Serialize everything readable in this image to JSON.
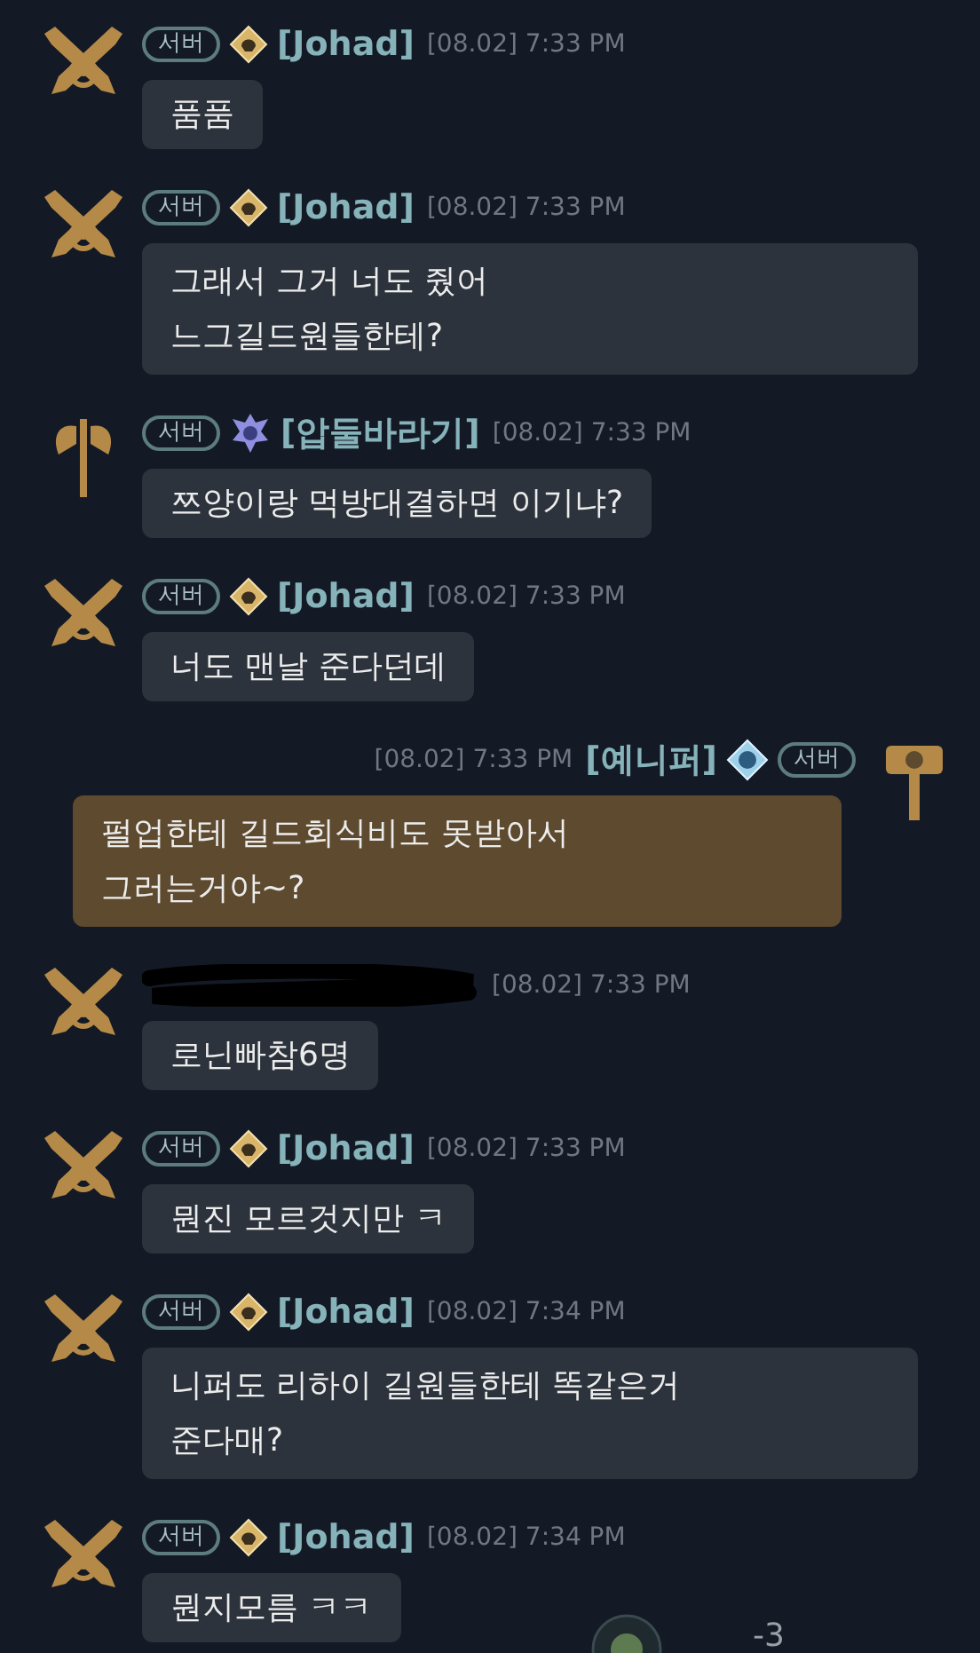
{
  "messages": [
    {
      "kind": "incoming",
      "avatar": {
        "kind": "guns"
      },
      "badge": "서버",
      "rank_icon": {
        "kind": "gold"
      },
      "name": "[Johad]",
      "time": "[08.02] 7:33 PM",
      "lines": [
        "품품"
      ]
    },
    {
      "kind": "incoming",
      "avatar": {
        "kind": "guns"
      },
      "badge": "서버",
      "rank_icon": {
        "kind": "gold"
      },
      "name": "[Johad]",
      "time": "[08.02] 7:33 PM",
      "lines": [
        "그래서 그거 너도 줬어",
        "느그길드원들한테?"
      ]
    },
    {
      "kind": "incoming",
      "avatar": {
        "kind": "axe"
      },
      "badge": "서버",
      "rank_icon": {
        "kind": "violet"
      },
      "name": "[압둘바라기]",
      "time": "[08.02] 7:33 PM",
      "lines": [
        "쯔양이랑 먹방대결하면 이기냐?"
      ]
    },
    {
      "kind": "incoming",
      "avatar": {
        "kind": "guns"
      },
      "badge": "서버",
      "rank_icon": {
        "kind": "gold"
      },
      "name": "[Johad]",
      "time": "[08.02] 7:33 PM",
      "lines": [
        "너도 맨날 준다던데"
      ]
    },
    {
      "kind": "outgoing",
      "avatar": {
        "kind": "hammer"
      },
      "badge": "서버",
      "rank_icon": {
        "kind": "blue"
      },
      "name": "[예니퍼]",
      "time": "[08.02] 7:33 PM",
      "lines": [
        "펄업한테 길드회식비도 못받아서",
        "그러는거야~?"
      ]
    },
    {
      "kind": "incoming",
      "avatar": {
        "kind": "guns"
      },
      "redacted": true,
      "time": "[08.02] 7:33 PM",
      "lines": [
        "로닌빠참6명"
      ]
    },
    {
      "kind": "incoming",
      "avatar": {
        "kind": "guns"
      },
      "badge": "서버",
      "rank_icon": {
        "kind": "gold"
      },
      "name": "[Johad]",
      "time": "[08.02] 7:33 PM",
      "lines": [
        "뭔진 모르것지만 ㅋ"
      ]
    },
    {
      "kind": "incoming",
      "avatar": {
        "kind": "guns"
      },
      "badge": "서버",
      "rank_icon": {
        "kind": "gold"
      },
      "name": "[Johad]",
      "time": "[08.02] 7:34 PM",
      "lines": [
        "니퍼도 리하이 길원들한테 똑같은거",
        "준다매?"
      ]
    },
    {
      "kind": "incoming",
      "avatar": {
        "kind": "guns"
      },
      "badge": "서버",
      "rank_icon": {
        "kind": "gold"
      },
      "name": "[Johad]",
      "time": "[08.02] 7:34 PM",
      "lines": [
        "뭔지모름 ㅋㅋ"
      ]
    }
  ],
  "bottom_counter": "-3"
}
